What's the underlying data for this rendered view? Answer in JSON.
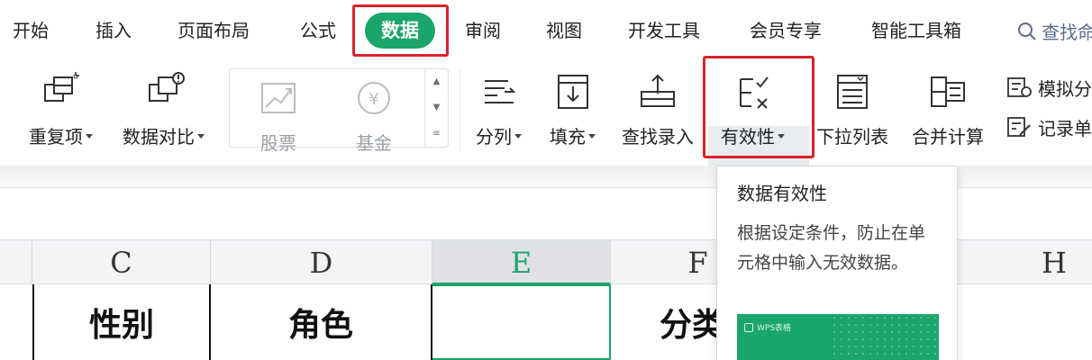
{
  "menu": {
    "tabs": [
      "开始",
      "插入",
      "页面布局",
      "公式",
      "数据",
      "审阅",
      "视图",
      "开发工具",
      "会员专享",
      "智能工具箱"
    ],
    "active_tab": "数据",
    "search_label": "查找命",
    "accent_color": "#1aa56b",
    "highlight_color": "#d9222a"
  },
  "ribbon": {
    "repeat": "重复项",
    "compare": "数据对比",
    "stocks": "股票",
    "funds": "基金",
    "split_column": "分列",
    "fill": "填充",
    "lookup_entry": "查找录入",
    "validity": "有效性",
    "dropdown_list": "下拉列表",
    "consolidate": "合并计算",
    "simulate": "模拟分",
    "record": "记录单"
  },
  "sheet": {
    "columns": [
      "C",
      "D",
      "E",
      "F",
      "H"
    ],
    "selected_column": "E",
    "cells": [
      "性别",
      "角色",
      "",
      "分类"
    ]
  },
  "tooltip": {
    "title": "数据有效性",
    "body": "根据设定条件，防止在单元格中输入无效数据。",
    "preview_label": "WPS表格"
  }
}
